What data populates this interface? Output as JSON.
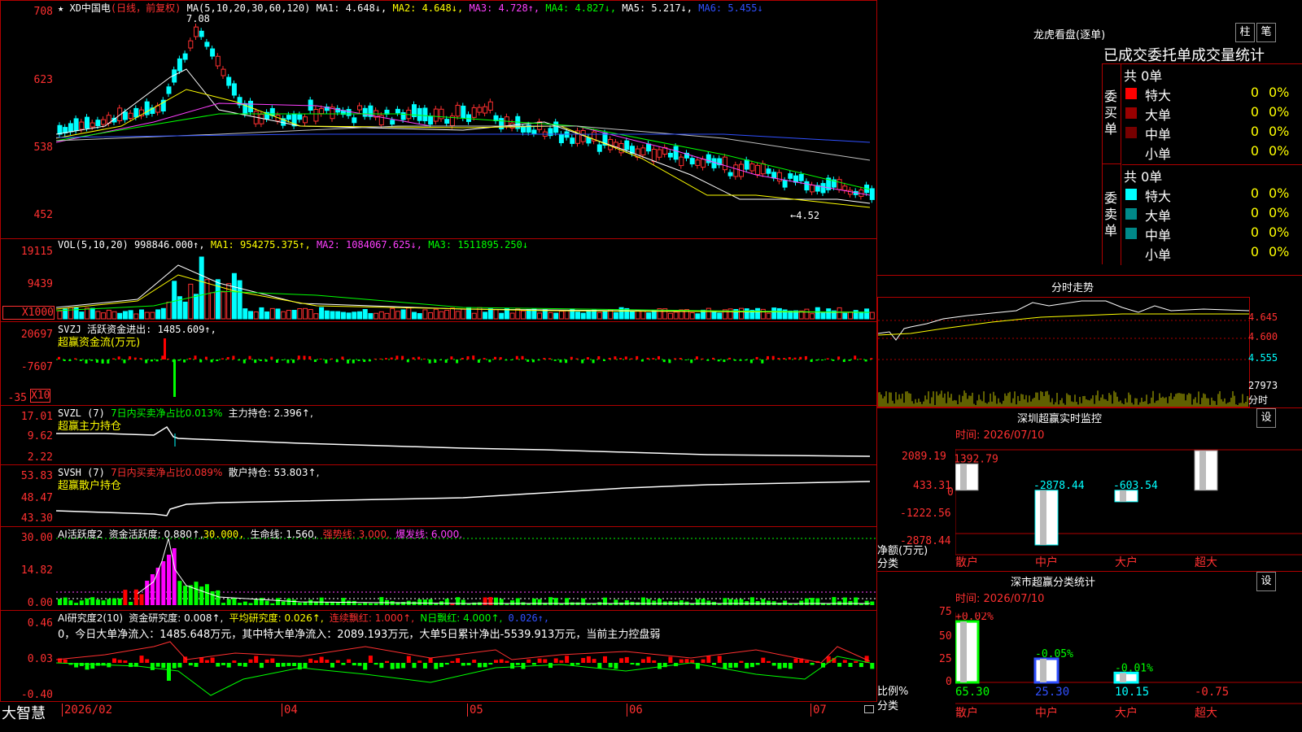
{
  "main_header": {
    "title": "XD中国电",
    "period": "(日线，前复权)",
    "ma_params": "MA(5,10,20,30,60,120)",
    "ma1": "MA1: 4.648↓,",
    "ma2": "MA2: 4.648↓,",
    "ma3": "MA3: 4.728↑,",
    "ma4": "MA4: 4.827↓,",
    "ma5": "MA5: 5.217↓,",
    "ma6": "MA6: 5.455↓"
  },
  "price_axis": [
    "708",
    "623",
    "538",
    "452"
  ],
  "price_high_label": "7.08",
  "price_low_label": "←4.52",
  "vol_header": {
    "name": "VOL(5,10,20)",
    "value": "998846.000↑,",
    "ma1": "MA1: 954275.375↑,",
    "ma2": "MA2: 1084067.625↓,",
    "ma3": "MA3: 1511895.250↓"
  },
  "vol_axis": [
    "19115",
    "9439",
    "X1000"
  ],
  "svzj": {
    "header": "SVZJ  活跃资金进出: 1485.609↑,",
    "sub": "超赢资金流(万元)",
    "axis": [
      "20697",
      "-7607",
      "-35",
      "X10"
    ]
  },
  "svzl": {
    "name": "SVZL (7)",
    "ratio": "7日内买卖净占比0.013%",
    "hold": "主力持仓: 2.396↑,",
    "sub": "超赢主力持仓",
    "axis": [
      "17.01",
      "9.62",
      "2.22"
    ]
  },
  "svsh": {
    "name": "SVSH (7)",
    "ratio": "7日内买卖净占比0.089%",
    "hold": "散户持仓: 53.803↑,",
    "sub": "超赢散户持仓",
    "axis": [
      "53.83",
      "48.47",
      "43.30"
    ]
  },
  "ai_active": {
    "name": "AI活跃度2",
    "v1": "资金活跃度: 0.880↑,",
    "v2": "30.000,",
    "v3": "生命线: 1.560,",
    "v4": "强势线: 3.000,",
    "v5": "爆发线: 6.000,",
    "axis": [
      "30.00",
      "14.82",
      "0.00"
    ]
  },
  "ai_research": {
    "name": "AI研究度2(10)",
    "v1": "资金研究度: 0.008↑,",
    "v2": "平均研究度: 0.026↑,",
    "v3": "连续飘红: 1.000↑,",
    "v4": "N日飘红: 4.000↑,",
    "v5": "0.026↑,",
    "line2": "0，今日大单净流入：1485.648万元，其中特大单净流入：2089.193万元，大单5日累计净出-5539.913万元，当前主力控盘弱",
    "axis": [
      "0.46",
      "0.03",
      "-0.40"
    ]
  },
  "date_axis": [
    "2026/02",
    "04",
    "05",
    "06",
    "07"
  ],
  "logo": "大智慧",
  "longhu": {
    "title": "龙虎看盘(逐单)",
    "btn1": "柱",
    "btn2": "笔",
    "subtitle": "已成交委托单成交量统计",
    "buy_label": "委买单",
    "sell_label": "委卖单",
    "buy_total": "共 0单",
    "sell_total": "共 0单",
    "buy_rows": [
      {
        "name": "特大",
        "n": "0",
        "p": "0%"
      },
      {
        "name": "大单",
        "n": "0",
        "p": "0%"
      },
      {
        "name": "中单",
        "n": "0",
        "p": "0%"
      },
      {
        "name": "小单",
        "n": "0",
        "p": "0%"
      }
    ],
    "sell_rows": [
      {
        "name": "特大",
        "n": "0",
        "p": "0%"
      },
      {
        "name": "大单",
        "n": "0",
        "p": "0%"
      },
      {
        "name": "中单",
        "n": "0",
        "p": "0%"
      },
      {
        "name": "小单",
        "n": "0",
        "p": "0%"
      }
    ],
    "colors": {
      "buy": [
        "#ff0000",
        "#990000",
        "#770000",
        ""
      ],
      "sell": [
        "#00ffff",
        "#008888",
        "#008888",
        ""
      ]
    }
  },
  "intraday": {
    "title": "分时走势",
    "axis": [
      "4.645",
      "4.600",
      "4.555"
    ],
    "vol_label": "27973",
    "vol_unit": "分时"
  },
  "sz_monitor": {
    "title": "深圳超赢实时监控",
    "btn": "设",
    "time": "时间: 2026/07/10",
    "axis": [
      "2089.19",
      "433.31",
      "0",
      "-1222.56",
      "-2878.44"
    ],
    "ylabel": "净额(万元)",
    "xlabel": "分类",
    "chart_data": {
      "type": "bar",
      "categories": [
        "散户",
        "中户",
        "大户",
        "超大"
      ],
      "values": [
        1392.79,
        -2878.44,
        -603.54,
        2089.19
      ],
      "labels": [
        "1392.79",
        "-2878.44",
        "-603.54",
        "2089.19"
      ],
      "ylim": [
        -2878.44,
        2089.19
      ]
    }
  },
  "sz_class": {
    "title": "深市超赢分类统计",
    "btn": "设",
    "time": "时间: 2026/07/10",
    "axis": [
      "75",
      "50",
      "25",
      "0"
    ],
    "ylabel": "比例%",
    "xlabel": "分类",
    "chart_data": {
      "type": "bar",
      "categories": [
        "散户",
        "中户",
        "大户",
        "超大"
      ],
      "values": [
        65.3,
        25.3,
        10.15,
        -0.75
      ],
      "top_labels": [
        "+0.02%",
        "-0.05%",
        "-0.01%",
        ""
      ],
      "bottom_labels": [
        "65.30",
        "25.30",
        "10.15",
        "-0.75"
      ],
      "ylim": [
        0,
        75
      ]
    }
  }
}
